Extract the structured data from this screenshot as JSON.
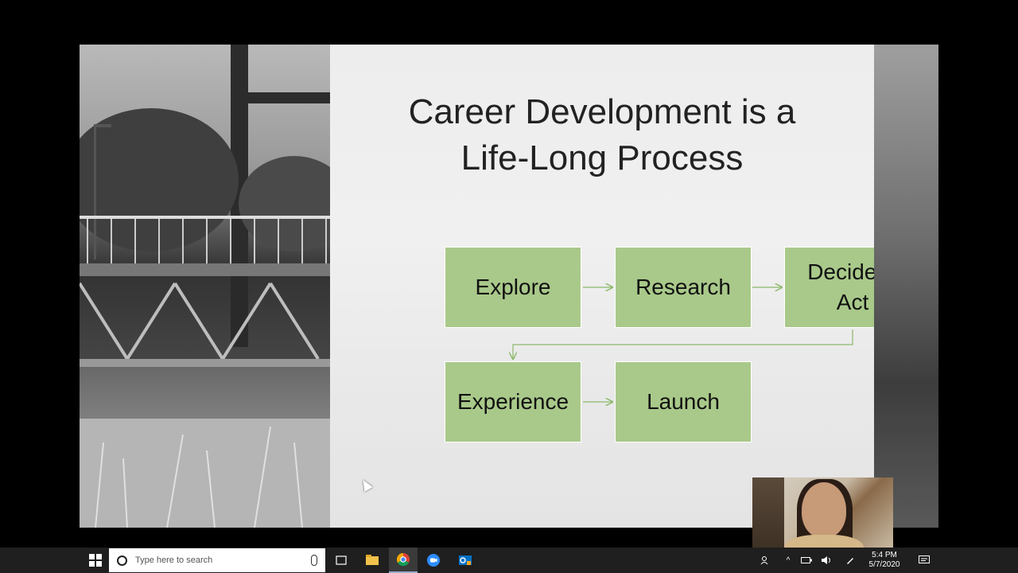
{
  "slide": {
    "title_line1": "Career Development is a",
    "title_line2": "Life-Long Process",
    "steps": [
      {
        "label_line1": "Explore",
        "label_line2": ""
      },
      {
        "label_line1": "Research",
        "label_line2": ""
      },
      {
        "label_line1": "Decide &",
        "label_line2": "Act"
      },
      {
        "label_line1": "Experience",
        "label_line2": ""
      },
      {
        "label_line1": "Launch",
        "label_line2": ""
      }
    ],
    "box_color": "#a9c98a",
    "arrow_color": "#8cb86a"
  },
  "taskbar": {
    "search_placeholder": "Type here to search",
    "clock_time": "5:4 PM",
    "clock_date": "5/7/2020",
    "apps": [
      "task-view-icon",
      "file-explorer-icon",
      "chrome-icon",
      "zoom-icon",
      "outlook-icon"
    ]
  },
  "colors": {
    "taskbar": "#1f1f1f",
    "title_text": "#222222"
  }
}
